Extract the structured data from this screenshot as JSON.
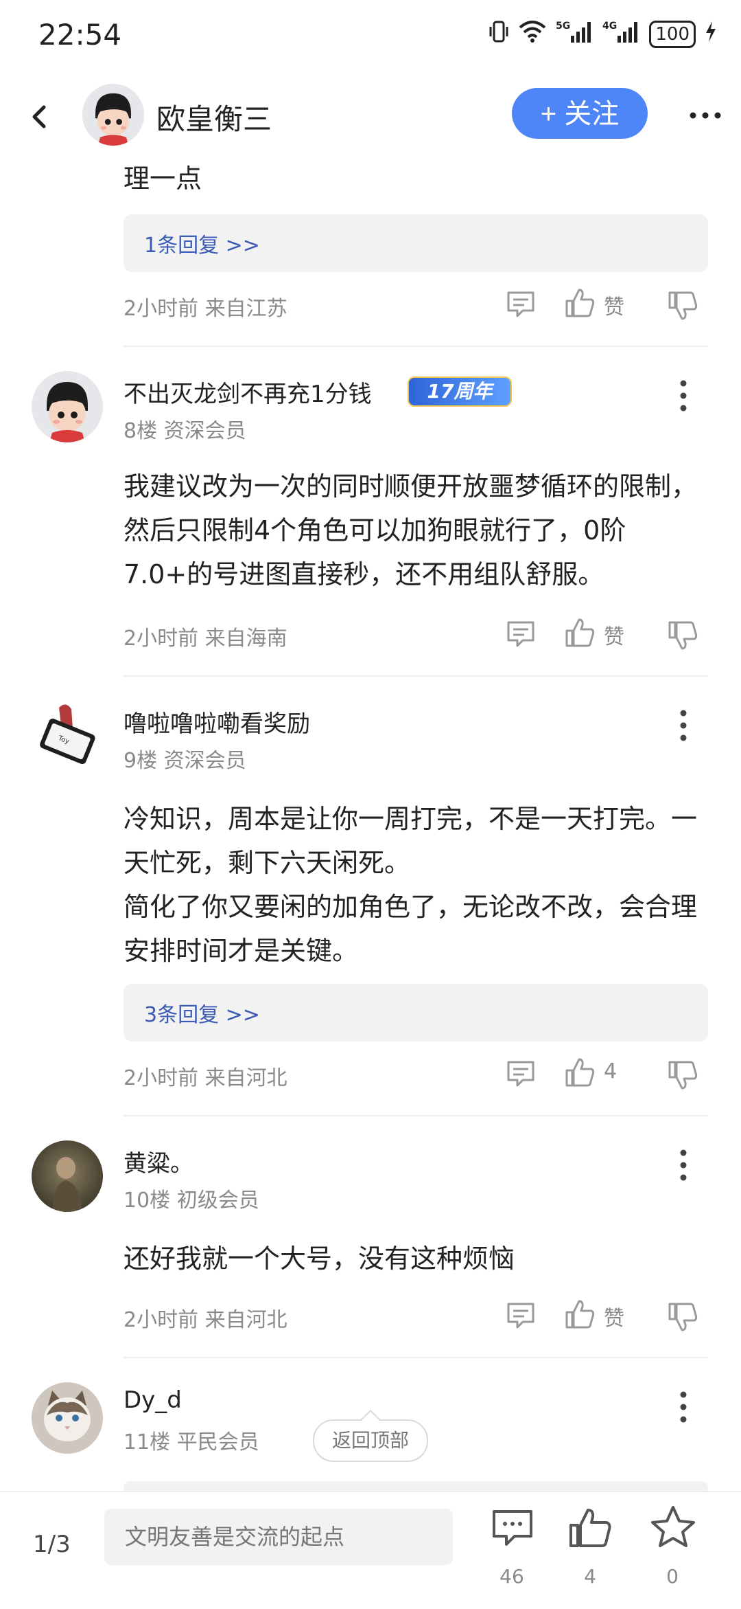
{
  "status_bar": {
    "time": "22:54",
    "network": "5G 4G",
    "battery": "100"
  },
  "header": {
    "author": "欧皇衡三",
    "follow_label": "+ 关注"
  },
  "comments": [
    {
      "text": "理一点",
      "reply_count": "1条回复 >>",
      "meta": "2小时前 来自江苏",
      "like_label": "赞"
    },
    {
      "user": "不出灭龙剑不再充1分钱",
      "badge": "17周年",
      "floor_level": "8楼 资深会员",
      "text": "我建议改为一次的同时顺便开放噩梦循环的限制，然后只限制4个角色可以加狗眼就行了，0阶7.0+的号进图直接秒，还不用组队舒服。",
      "meta": "2小时前 来自海南",
      "like_label": "赞"
    },
    {
      "user": "噜啦噜啦嘞看奖励",
      "floor_level": "9楼 资深会员",
      "text": "冷知识，周本是让你一周打完，不是一天打完。一天忙死，剩下六天闲死。",
      "text2": "简化了你又要闲的加角色了，无论改不改，会合理安排时间才是关键。",
      "reply_count": "3条回复 >>",
      "meta": "2小时前 来自河北",
      "like_label": "4"
    },
    {
      "user": "黄粱。",
      "floor_level": "10楼 初级会员",
      "text": "还好我就一个大号，没有这种烦恼",
      "meta": "2小时前 来自河北",
      "like_label": "赞"
    },
    {
      "user": "Dy_d",
      "floor_level": "11楼 平民会员"
    }
  ],
  "back_to_top": "返回顶部",
  "bottom_bar": {
    "page": "1/3",
    "input_placeholder": "文明友善是交流的起点",
    "comment_count": "46",
    "like_count": "4",
    "star_count": "0"
  }
}
